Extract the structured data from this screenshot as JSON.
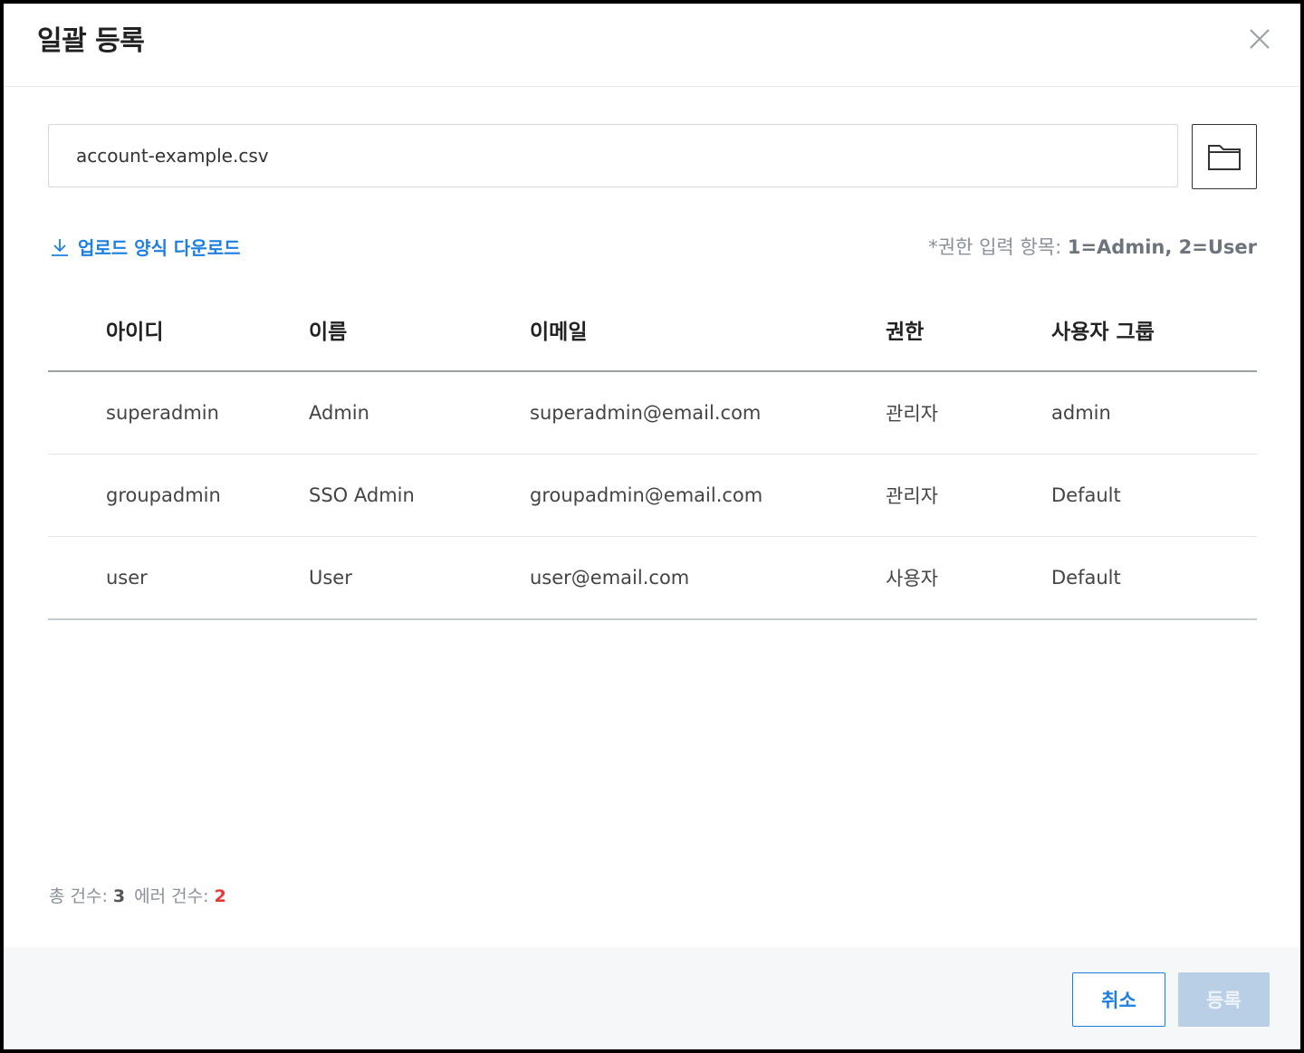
{
  "dialog": {
    "title": "일괄 등록"
  },
  "file": {
    "value": "account-example.csv"
  },
  "download": {
    "label": "업로드 양식 다운로드"
  },
  "role_hint": {
    "prefix": "*권한 입력 항목: ",
    "values": "1=Admin, 2=User"
  },
  "table": {
    "columns": [
      "아이디",
      "이름",
      "이메일",
      "권한",
      "사용자 그룹"
    ],
    "rows": [
      [
        "superadmin",
        "Admin",
        "superadmin@email.com",
        "관리자",
        "admin"
      ],
      [
        "groupadmin",
        "SSO Admin",
        "groupadmin@email.com",
        "관리자",
        "Default"
      ],
      [
        "user",
        "User",
        "user@email.com",
        "사용자",
        "Default"
      ]
    ]
  },
  "summary": {
    "total_label": "총 건수: ",
    "total_value": "3",
    "error_label": "에러 건수: ",
    "error_value": "2"
  },
  "footer": {
    "cancel_label": "취소",
    "submit_label": "등록"
  },
  "colors": {
    "accent": "#1d7fe0",
    "error": "#e53935",
    "disabled_button": "#b8cfe6"
  }
}
